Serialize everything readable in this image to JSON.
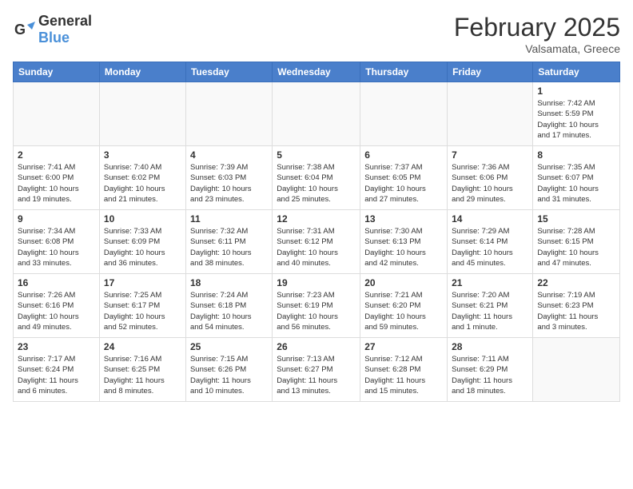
{
  "header": {
    "logo_general": "General",
    "logo_blue": "Blue",
    "title": "February 2025",
    "subtitle": "Valsamata, Greece"
  },
  "weekdays": [
    "Sunday",
    "Monday",
    "Tuesday",
    "Wednesday",
    "Thursday",
    "Friday",
    "Saturday"
  ],
  "weeks": [
    [
      {
        "day": "",
        "info": ""
      },
      {
        "day": "",
        "info": ""
      },
      {
        "day": "",
        "info": ""
      },
      {
        "day": "",
        "info": ""
      },
      {
        "day": "",
        "info": ""
      },
      {
        "day": "",
        "info": ""
      },
      {
        "day": "1",
        "info": "Sunrise: 7:42 AM\nSunset: 5:59 PM\nDaylight: 10 hours\nand 17 minutes."
      }
    ],
    [
      {
        "day": "2",
        "info": "Sunrise: 7:41 AM\nSunset: 6:00 PM\nDaylight: 10 hours\nand 19 minutes."
      },
      {
        "day": "3",
        "info": "Sunrise: 7:40 AM\nSunset: 6:02 PM\nDaylight: 10 hours\nand 21 minutes."
      },
      {
        "day": "4",
        "info": "Sunrise: 7:39 AM\nSunset: 6:03 PM\nDaylight: 10 hours\nand 23 minutes."
      },
      {
        "day": "5",
        "info": "Sunrise: 7:38 AM\nSunset: 6:04 PM\nDaylight: 10 hours\nand 25 minutes."
      },
      {
        "day": "6",
        "info": "Sunrise: 7:37 AM\nSunset: 6:05 PM\nDaylight: 10 hours\nand 27 minutes."
      },
      {
        "day": "7",
        "info": "Sunrise: 7:36 AM\nSunset: 6:06 PM\nDaylight: 10 hours\nand 29 minutes."
      },
      {
        "day": "8",
        "info": "Sunrise: 7:35 AM\nSunset: 6:07 PM\nDaylight: 10 hours\nand 31 minutes."
      }
    ],
    [
      {
        "day": "9",
        "info": "Sunrise: 7:34 AM\nSunset: 6:08 PM\nDaylight: 10 hours\nand 33 minutes."
      },
      {
        "day": "10",
        "info": "Sunrise: 7:33 AM\nSunset: 6:09 PM\nDaylight: 10 hours\nand 36 minutes."
      },
      {
        "day": "11",
        "info": "Sunrise: 7:32 AM\nSunset: 6:11 PM\nDaylight: 10 hours\nand 38 minutes."
      },
      {
        "day": "12",
        "info": "Sunrise: 7:31 AM\nSunset: 6:12 PM\nDaylight: 10 hours\nand 40 minutes."
      },
      {
        "day": "13",
        "info": "Sunrise: 7:30 AM\nSunset: 6:13 PM\nDaylight: 10 hours\nand 42 minutes."
      },
      {
        "day": "14",
        "info": "Sunrise: 7:29 AM\nSunset: 6:14 PM\nDaylight: 10 hours\nand 45 minutes."
      },
      {
        "day": "15",
        "info": "Sunrise: 7:28 AM\nSunset: 6:15 PM\nDaylight: 10 hours\nand 47 minutes."
      }
    ],
    [
      {
        "day": "16",
        "info": "Sunrise: 7:26 AM\nSunset: 6:16 PM\nDaylight: 10 hours\nand 49 minutes."
      },
      {
        "day": "17",
        "info": "Sunrise: 7:25 AM\nSunset: 6:17 PM\nDaylight: 10 hours\nand 52 minutes."
      },
      {
        "day": "18",
        "info": "Sunrise: 7:24 AM\nSunset: 6:18 PM\nDaylight: 10 hours\nand 54 minutes."
      },
      {
        "day": "19",
        "info": "Sunrise: 7:23 AM\nSunset: 6:19 PM\nDaylight: 10 hours\nand 56 minutes."
      },
      {
        "day": "20",
        "info": "Sunrise: 7:21 AM\nSunset: 6:20 PM\nDaylight: 10 hours\nand 59 minutes."
      },
      {
        "day": "21",
        "info": "Sunrise: 7:20 AM\nSunset: 6:21 PM\nDaylight: 11 hours\nand 1 minute."
      },
      {
        "day": "22",
        "info": "Sunrise: 7:19 AM\nSunset: 6:23 PM\nDaylight: 11 hours\nand 3 minutes."
      }
    ],
    [
      {
        "day": "23",
        "info": "Sunrise: 7:17 AM\nSunset: 6:24 PM\nDaylight: 11 hours\nand 6 minutes."
      },
      {
        "day": "24",
        "info": "Sunrise: 7:16 AM\nSunset: 6:25 PM\nDaylight: 11 hours\nand 8 minutes."
      },
      {
        "day": "25",
        "info": "Sunrise: 7:15 AM\nSunset: 6:26 PM\nDaylight: 11 hours\nand 10 minutes."
      },
      {
        "day": "26",
        "info": "Sunrise: 7:13 AM\nSunset: 6:27 PM\nDaylight: 11 hours\nand 13 minutes."
      },
      {
        "day": "27",
        "info": "Sunrise: 7:12 AM\nSunset: 6:28 PM\nDaylight: 11 hours\nand 15 minutes."
      },
      {
        "day": "28",
        "info": "Sunrise: 7:11 AM\nSunset: 6:29 PM\nDaylight: 11 hours\nand 18 minutes."
      },
      {
        "day": "",
        "info": ""
      }
    ]
  ]
}
